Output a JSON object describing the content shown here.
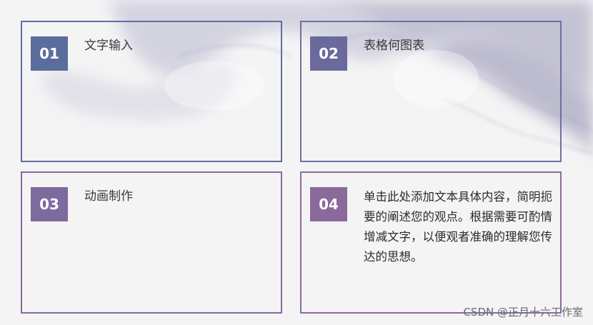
{
  "cards": [
    {
      "number": "01",
      "title": "文字输入"
    },
    {
      "number": "02",
      "title": "表格何图表"
    },
    {
      "number": "03",
      "title": "动画制作"
    },
    {
      "number": "04",
      "body": "单击此处添加文本具体内容，简明扼要的阐述您的观点。根据需要可酌情增减文字，以便观者准确的理解您传达的思想。"
    }
  ],
  "watermark": "CSDN @正月十六工作室",
  "colors": {
    "card1": "#5a6d9c",
    "card2": "#6b6a9d",
    "card3": "#7d6a9e",
    "card4": "#8a6a9b"
  }
}
